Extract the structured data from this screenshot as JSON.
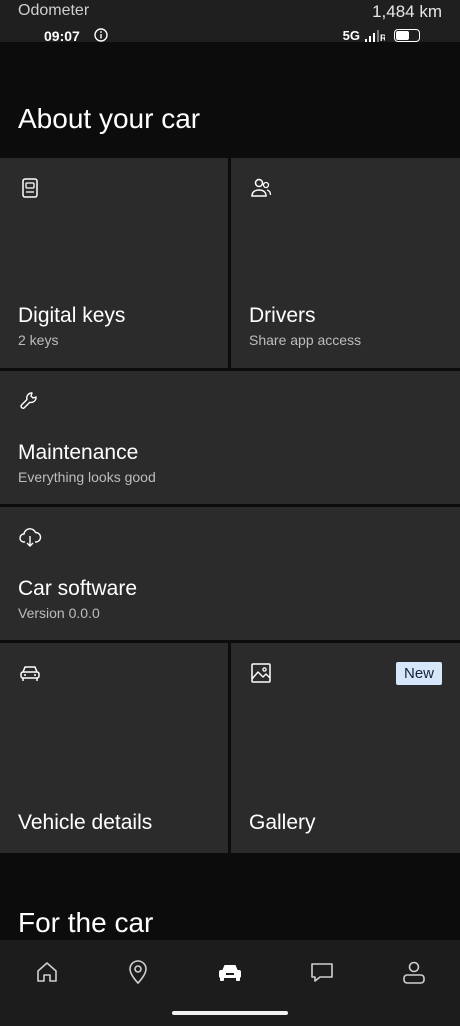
{
  "status": {
    "odometer_label": "Odometer",
    "odometer_value": "1,484 km",
    "time": "09:07",
    "network": "5G",
    "signal": ".ılıR"
  },
  "sections": {
    "about_title": "About your car",
    "for_title": "For the car"
  },
  "tiles": {
    "digital_keys": {
      "title": "Digital keys",
      "subtitle": "2 keys",
      "icon": "key-card-icon"
    },
    "drivers": {
      "title": "Drivers",
      "subtitle": "Share app access",
      "icon": "users-icon"
    },
    "maintenance": {
      "title": "Maintenance",
      "subtitle": "Everything looks good",
      "icon": "wrench-icon"
    },
    "car_software": {
      "title": "Car software",
      "subtitle": "Version 0.0.0",
      "icon": "cloud-download-icon"
    },
    "vehicle_details": {
      "title": "Vehicle details",
      "icon": "car-icon"
    },
    "gallery": {
      "title": "Gallery",
      "badge": "New",
      "icon": "image-icon"
    }
  },
  "nav": {
    "items": [
      {
        "icon": "home-icon"
      },
      {
        "icon": "location-pin-icon"
      },
      {
        "icon": "car-icon",
        "active": true
      },
      {
        "icon": "chat-icon"
      },
      {
        "icon": "profile-icon"
      }
    ]
  },
  "colors": {
    "background": "#0c0c0c",
    "tile": "#2b2b2b",
    "badge": "#d6e6fb",
    "nav": "#1c1c1c"
  }
}
